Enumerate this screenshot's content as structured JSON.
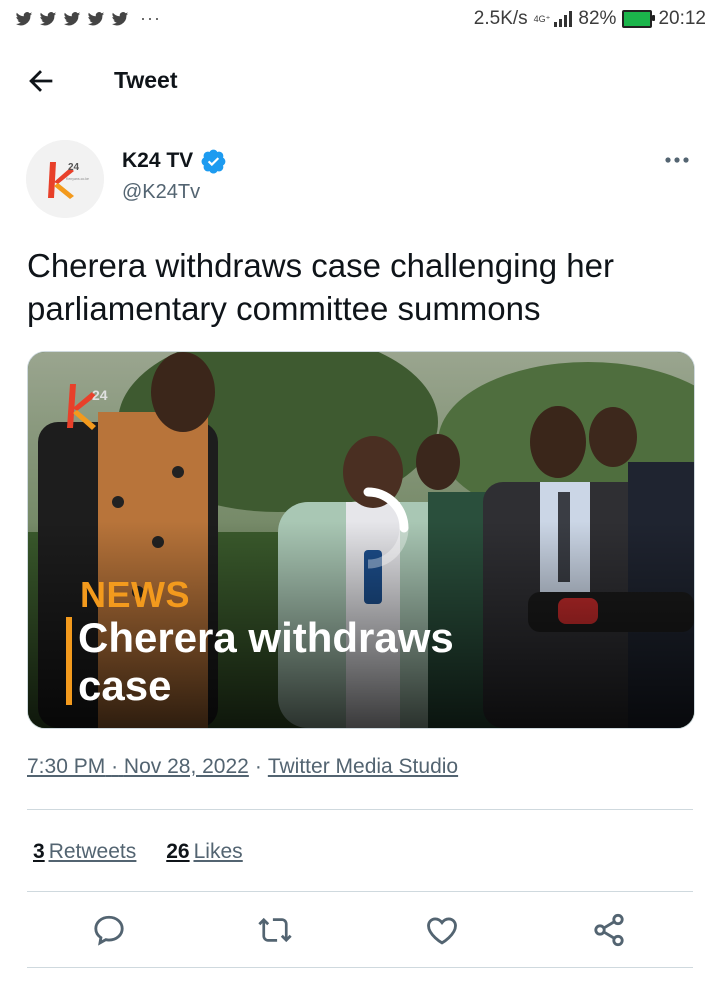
{
  "status_bar": {
    "speed": "2.5K/s",
    "network_top": "4G⁺",
    "battery": "82%",
    "time": "20:12",
    "more": "···"
  },
  "header": {
    "title": "Tweet"
  },
  "author": {
    "name": "K24 TV",
    "handle": "@K24Tv",
    "avatar_text": "24",
    "avatar_sub": "Kenyans.co.ke"
  },
  "tweet": {
    "text": "Cherera withdraws case challenging her parliamentary committee summons"
  },
  "media": {
    "logo_text": "24",
    "overlay_tag": "NEWS",
    "overlay_line1": "Cherera withdraws",
    "overlay_line2": "case"
  },
  "meta": {
    "time": "7:30 PM",
    "date": "Nov 28, 2022",
    "separator": "·",
    "source": "Twitter Media Studio"
  },
  "stats": {
    "retweets_count": "3",
    "retweets_label": "Retweets",
    "likes_count": "26",
    "likes_label": "Likes"
  },
  "colors": {
    "accent_orange": "#f39a1d",
    "verified_blue": "#1d9bf0",
    "text_secondary": "#536471"
  },
  "icons": [
    "back-arrow-icon",
    "verified-badge-icon",
    "more-dots-icon",
    "reply-icon",
    "retweet-icon",
    "like-icon",
    "share-icon"
  ]
}
